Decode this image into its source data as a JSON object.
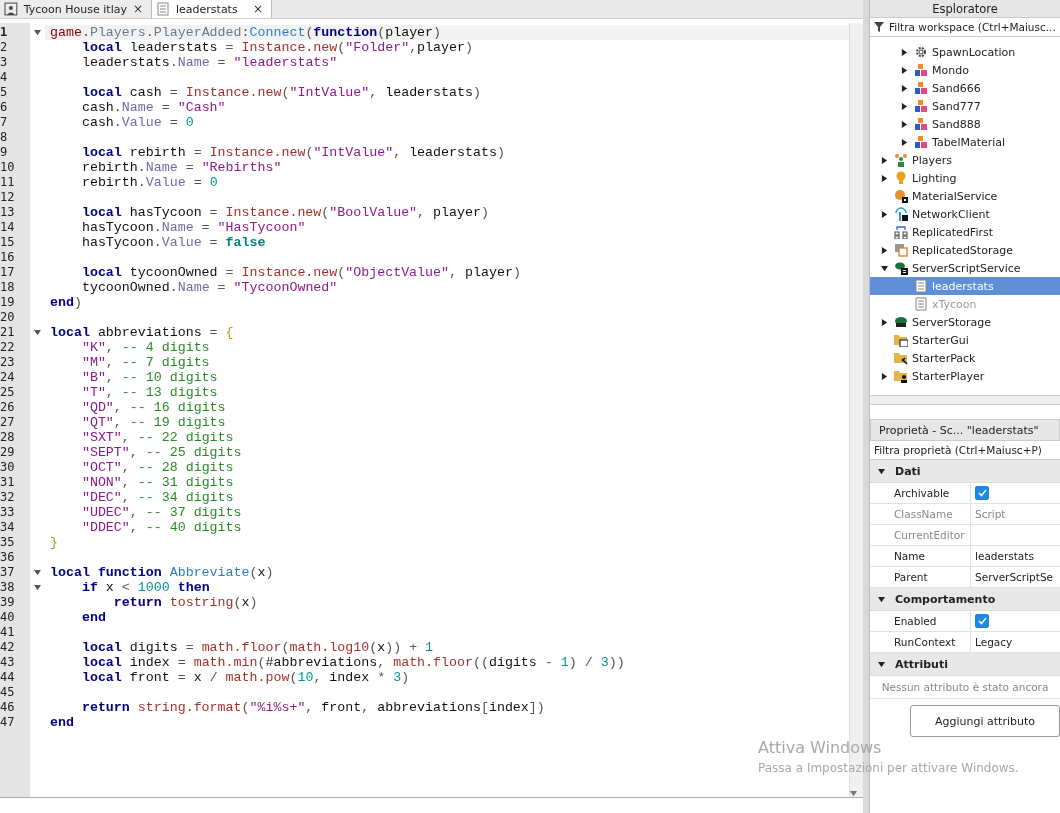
{
  "editor": {
    "tabs": [
      {
        "label": "Tycoon House itlay",
        "close": "×",
        "selected": false
      },
      {
        "label": "leaderstats",
        "close": "×",
        "selected": true
      }
    ],
    "lines": [
      {
        "n": "1",
        "fold": true,
        "current": true,
        "tokens": [
          {
            "kind": "g",
            "text": "game"
          },
          {
            "kind": "op",
            "text": "."
          },
          {
            "kind": "mem",
            "text": "Players"
          },
          {
            "kind": "op",
            "text": "."
          },
          {
            "kind": "mem",
            "text": "PlayerAdded"
          },
          {
            "kind": "op",
            "text": ":"
          },
          {
            "kind": "meth",
            "text": "Connect"
          },
          {
            "kind": "op",
            "text": "("
          },
          {
            "kind": "kw",
            "text": "function"
          },
          {
            "kind": "op",
            "text": "("
          },
          {
            "kind": "id",
            "text": "player"
          },
          {
            "kind": "op",
            "text": ")"
          }
        ]
      },
      {
        "n": "2",
        "fold": false,
        "current": false,
        "tokens": [
          {
            "kind": "kw",
            "text": "    local"
          },
          {
            "kind": "id",
            "text": " leaderstats "
          },
          {
            "kind": "op",
            "text": "= "
          },
          {
            "kind": "fn",
            "text": "Instance.new"
          },
          {
            "kind": "op",
            "text": "("
          },
          {
            "kind": "str",
            "text": "\"Folder\""
          },
          {
            "kind": "op",
            "text": ","
          },
          {
            "kind": "id",
            "text": "player"
          },
          {
            "kind": "op",
            "text": ")"
          }
        ]
      },
      {
        "n": "3",
        "fold": false,
        "current": false,
        "tokens": [
          {
            "kind": "id",
            "text": "    leaderstats"
          },
          {
            "kind": "op",
            "text": "."
          },
          {
            "kind": "prop",
            "text": "Name"
          },
          {
            "kind": "op",
            "text": " = "
          },
          {
            "kind": "str",
            "text": "\"leaderstats\""
          }
        ]
      },
      {
        "n": "4",
        "fold": false,
        "current": false
      },
      {
        "n": "5",
        "fold": false,
        "current": false,
        "tokens": [
          {
            "kind": "kw",
            "text": "    local"
          },
          {
            "kind": "id",
            "text": " cash "
          },
          {
            "kind": "op",
            "text": "= "
          },
          {
            "kind": "fn",
            "text": "Instance.new"
          },
          {
            "kind": "op",
            "text": "("
          },
          {
            "kind": "str",
            "text": "\"IntValue\""
          },
          {
            "kind": "op",
            "text": ", "
          },
          {
            "kind": "id",
            "text": "leaderstats"
          },
          {
            "kind": "op",
            "text": ")"
          }
        ]
      },
      {
        "n": "6",
        "fold": false,
        "current": false,
        "tokens": [
          {
            "kind": "id",
            "text": "    cash"
          },
          {
            "kind": "op",
            "text": "."
          },
          {
            "kind": "prop",
            "text": "Name"
          },
          {
            "kind": "op",
            "text": " = "
          },
          {
            "kind": "str",
            "text": "\"Cash\""
          }
        ]
      },
      {
        "n": "7",
        "fold": false,
        "current": false,
        "tokens": [
          {
            "kind": "id",
            "text": "    cash"
          },
          {
            "kind": "op",
            "text": "."
          },
          {
            "kind": "prop",
            "text": "Value"
          },
          {
            "kind": "op",
            "text": " = "
          },
          {
            "kind": "num",
            "text": "0"
          }
        ]
      },
      {
        "n": "8",
        "fold": false,
        "current": false
      },
      {
        "n": "9",
        "fold": false,
        "current": false,
        "tokens": [
          {
            "kind": "kw",
            "text": "    local"
          },
          {
            "kind": "id",
            "text": " rebirth "
          },
          {
            "kind": "op",
            "text": "= "
          },
          {
            "kind": "fn",
            "text": "Instance.new"
          },
          {
            "kind": "op",
            "text": "("
          },
          {
            "kind": "str",
            "text": "\"IntValue\""
          },
          {
            "kind": "op",
            "text": ", "
          },
          {
            "kind": "id",
            "text": "leaderstats"
          },
          {
            "kind": "op",
            "text": ")"
          }
        ]
      },
      {
        "n": "10",
        "fold": false,
        "current": false,
        "tokens": [
          {
            "kind": "id",
            "text": "    rebirth"
          },
          {
            "kind": "op",
            "text": "."
          },
          {
            "kind": "prop",
            "text": "Name"
          },
          {
            "kind": "op",
            "text": " = "
          },
          {
            "kind": "str",
            "text": "\"Rebirths\""
          }
        ]
      },
      {
        "n": "11",
        "fold": false,
        "current": false,
        "tokens": [
          {
            "kind": "id",
            "text": "    rebirth"
          },
          {
            "kind": "op",
            "text": "."
          },
          {
            "kind": "prop",
            "text": "Value"
          },
          {
            "kind": "op",
            "text": " = "
          },
          {
            "kind": "num",
            "text": "0"
          }
        ]
      },
      {
        "n": "12",
        "fold": false,
        "current": false
      },
      {
        "n": "13",
        "fold": false,
        "current": false,
        "tokens": [
          {
            "kind": "kw",
            "text": "    local"
          },
          {
            "kind": "id",
            "text": " hasTycoon "
          },
          {
            "kind": "op",
            "text": "= "
          },
          {
            "kind": "fn",
            "text": "Instance.new"
          },
          {
            "kind": "op",
            "text": "("
          },
          {
            "kind": "str",
            "text": "\"BoolValue\""
          },
          {
            "kind": "op",
            "text": ", "
          },
          {
            "kind": "id",
            "text": "player"
          },
          {
            "kind": "op",
            "text": ")"
          }
        ]
      },
      {
        "n": "14",
        "fold": false,
        "current": false,
        "tokens": [
          {
            "kind": "id",
            "text": "    hasTycoon"
          },
          {
            "kind": "op",
            "text": "."
          },
          {
            "kind": "prop",
            "text": "Name"
          },
          {
            "kind": "op",
            "text": " = "
          },
          {
            "kind": "str",
            "text": "\"HasTycoon\""
          }
        ]
      },
      {
        "n": "15",
        "fold": false,
        "current": false,
        "tokens": [
          {
            "kind": "id",
            "text": "    hasTycoon"
          },
          {
            "kind": "op",
            "text": "."
          },
          {
            "kind": "prop",
            "text": "Value"
          },
          {
            "kind": "op",
            "text": " = "
          },
          {
            "kind": "bool",
            "text": "false"
          }
        ]
      },
      {
        "n": "16",
        "fold": false,
        "current": false
      },
      {
        "n": "17",
        "fold": false,
        "current": false,
        "tokens": [
          {
            "kind": "kw",
            "text": "    local"
          },
          {
            "kind": "id",
            "text": " tycoonOwned "
          },
          {
            "kind": "op",
            "text": "= "
          },
          {
            "kind": "fn",
            "text": "Instance.new"
          },
          {
            "kind": "op",
            "text": "("
          },
          {
            "kind": "str",
            "text": "\"ObjectValue\""
          },
          {
            "kind": "op",
            "text": ", "
          },
          {
            "kind": "id",
            "text": "player"
          },
          {
            "kind": "op",
            "text": ")"
          }
        ]
      },
      {
        "n": "18",
        "fold": false,
        "current": false,
        "tokens": [
          {
            "kind": "id",
            "text": "    tycoonOwned"
          },
          {
            "kind": "op",
            "text": "."
          },
          {
            "kind": "prop",
            "text": "Name"
          },
          {
            "kind": "op",
            "text": " = "
          },
          {
            "kind": "str",
            "text": "\"TycoonOwned\""
          }
        ]
      },
      {
        "n": "19",
        "fold": false,
        "current": false,
        "tokens": [
          {
            "kind": "kw",
            "text": "end"
          },
          {
            "kind": "op",
            "text": ")"
          }
        ]
      },
      {
        "n": "20",
        "fold": false,
        "current": false
      },
      {
        "n": "21",
        "fold": true,
        "current": false,
        "tokens": [
          {
            "kind": "kw",
            "text": "local"
          },
          {
            "kind": "id",
            "text": " abbreviations "
          },
          {
            "kind": "op",
            "text": "= "
          },
          {
            "kind": "brace",
            "text": "{"
          }
        ]
      },
      {
        "n": "22",
        "fold": false,
        "current": false,
        "tokens": [
          {
            "kind": "str",
            "text": "    \"K\""
          },
          {
            "kind": "op",
            "text": ", "
          },
          {
            "kind": "com",
            "text": "-- 4 digits"
          }
        ]
      },
      {
        "n": "23",
        "fold": false,
        "current": false,
        "tokens": [
          {
            "kind": "str",
            "text": "    \"M\""
          },
          {
            "kind": "op",
            "text": ", "
          },
          {
            "kind": "com",
            "text": "-- 7 digits"
          }
        ]
      },
      {
        "n": "24",
        "fold": false,
        "current": false,
        "tokens": [
          {
            "kind": "str",
            "text": "    \"B\""
          },
          {
            "kind": "op",
            "text": ", "
          },
          {
            "kind": "com",
            "text": "-- 10 digits"
          }
        ]
      },
      {
        "n": "25",
        "fold": false,
        "current": false,
        "tokens": [
          {
            "kind": "str",
            "text": "    \"T\""
          },
          {
            "kind": "op",
            "text": ", "
          },
          {
            "kind": "com",
            "text": "-- 13 digits"
          }
        ]
      },
      {
        "n": "26",
        "fold": false,
        "current": false,
        "tokens": [
          {
            "kind": "str",
            "text": "    \"QD\""
          },
          {
            "kind": "op",
            "text": ", "
          },
          {
            "kind": "com",
            "text": "-- 16 digits"
          }
        ]
      },
      {
        "n": "27",
        "fold": false,
        "current": false,
        "tokens": [
          {
            "kind": "str",
            "text": "    \"QT\""
          },
          {
            "kind": "op",
            "text": ", "
          },
          {
            "kind": "com",
            "text": "-- 19 digits"
          }
        ]
      },
      {
        "n": "28",
        "fold": false,
        "current": false,
        "tokens": [
          {
            "kind": "str",
            "text": "    \"SXT\""
          },
          {
            "kind": "op",
            "text": ", "
          },
          {
            "kind": "com",
            "text": "-- 22 digits"
          }
        ]
      },
      {
        "n": "29",
        "fold": false,
        "current": false,
        "tokens": [
          {
            "kind": "str",
            "text": "    \"SEPT\""
          },
          {
            "kind": "op",
            "text": ", "
          },
          {
            "kind": "com",
            "text": "-- 25 digits"
          }
        ]
      },
      {
        "n": "30",
        "fold": false,
        "current": false,
        "tokens": [
          {
            "kind": "str",
            "text": "    \"OCT\""
          },
          {
            "kind": "op",
            "text": ", "
          },
          {
            "kind": "com",
            "text": "-- 28 digits"
          }
        ]
      },
      {
        "n": "31",
        "fold": false,
        "current": false,
        "tokens": [
          {
            "kind": "str",
            "text": "    \"NON\""
          },
          {
            "kind": "op",
            "text": ", "
          },
          {
            "kind": "com",
            "text": "-- 31 digits"
          }
        ]
      },
      {
        "n": "32",
        "fold": false,
        "current": false,
        "tokens": [
          {
            "kind": "str",
            "text": "    \"DEC\""
          },
          {
            "kind": "op",
            "text": ", "
          },
          {
            "kind": "com",
            "text": "-- 34 digits"
          }
        ]
      },
      {
        "n": "33",
        "fold": false,
        "current": false,
        "tokens": [
          {
            "kind": "str",
            "text": "    \"UDEC\""
          },
          {
            "kind": "op",
            "text": ", "
          },
          {
            "kind": "com",
            "text": "-- 37 digits"
          }
        ]
      },
      {
        "n": "34",
        "fold": false,
        "current": false,
        "tokens": [
          {
            "kind": "str",
            "text": "    \"DDEC\""
          },
          {
            "kind": "op",
            "text": ", "
          },
          {
            "kind": "com",
            "text": "-- 40 digits"
          }
        ]
      },
      {
        "n": "35",
        "fold": false,
        "current": false,
        "tokens": [
          {
            "kind": "brace",
            "text": "}"
          }
        ]
      },
      {
        "n": "36",
        "fold": false,
        "current": false
      },
      {
        "n": "37",
        "fold": true,
        "current": false,
        "tokens": [
          {
            "kind": "kw",
            "text": "local function "
          },
          {
            "kind": "meth",
            "text": "Abbreviate"
          },
          {
            "kind": "op",
            "text": "("
          },
          {
            "kind": "id",
            "text": "x"
          },
          {
            "kind": "op",
            "text": ")"
          }
        ]
      },
      {
        "n": "38",
        "fold": true,
        "current": false,
        "tokens": [
          {
            "kind": "kw",
            "text": "    if"
          },
          {
            "kind": "id",
            "text": " x "
          },
          {
            "kind": "op",
            "text": "< "
          },
          {
            "kind": "num",
            "text": "1000"
          },
          {
            "kind": "kw",
            "text": " then"
          }
        ]
      },
      {
        "n": "39",
        "fold": false,
        "current": false,
        "tokens": [
          {
            "kind": "kw",
            "text": "        return"
          },
          {
            "kind": "fn",
            "text": " tostring"
          },
          {
            "kind": "op",
            "text": "("
          },
          {
            "kind": "id",
            "text": "x"
          },
          {
            "kind": "op",
            "text": ")"
          }
        ]
      },
      {
        "n": "40",
        "fold": false,
        "current": false,
        "tokens": [
          {
            "kind": "kw",
            "text": "    end"
          }
        ]
      },
      {
        "n": "41",
        "fold": false,
        "current": false
      },
      {
        "n": "42",
        "fold": false,
        "current": false,
        "tokens": [
          {
            "kind": "kw",
            "text": "    local"
          },
          {
            "kind": "id",
            "text": " digits "
          },
          {
            "kind": "op",
            "text": "= "
          },
          {
            "kind": "fn",
            "text": "math.floor"
          },
          {
            "kind": "op",
            "text": "("
          },
          {
            "kind": "fn",
            "text": "math.log10"
          },
          {
            "kind": "op",
            "text": "("
          },
          {
            "kind": "id",
            "text": "x"
          },
          {
            "kind": "op",
            "text": ")) + "
          },
          {
            "kind": "num",
            "text": "1"
          }
        ]
      },
      {
        "n": "43",
        "fold": false,
        "current": false,
        "tokens": [
          {
            "kind": "kw",
            "text": "    local"
          },
          {
            "kind": "id",
            "text": " index "
          },
          {
            "kind": "op",
            "text": "= "
          },
          {
            "kind": "fn",
            "text": "math.min"
          },
          {
            "kind": "op",
            "text": "("
          },
          {
            "kind": "id",
            "text": "#abbreviations"
          },
          {
            "kind": "op",
            "text": ", "
          },
          {
            "kind": "fn",
            "text": "math.floor"
          },
          {
            "kind": "op",
            "text": "(("
          },
          {
            "kind": "id",
            "text": "digits "
          },
          {
            "kind": "op",
            "text": "- "
          },
          {
            "kind": "num",
            "text": "1"
          },
          {
            "kind": "op",
            "text": ") / "
          },
          {
            "kind": "num",
            "text": "3"
          },
          {
            "kind": "op",
            "text": "))"
          }
        ]
      },
      {
        "n": "44",
        "fold": false,
        "current": false,
        "tokens": [
          {
            "kind": "kw",
            "text": "    local"
          },
          {
            "kind": "id",
            "text": " front "
          },
          {
            "kind": "op",
            "text": "= "
          },
          {
            "kind": "id",
            "text": "x "
          },
          {
            "kind": "op",
            "text": "/ "
          },
          {
            "kind": "fn",
            "text": "math.pow"
          },
          {
            "kind": "op",
            "text": "("
          },
          {
            "kind": "num",
            "text": "10"
          },
          {
            "kind": "op",
            "text": ", "
          },
          {
            "kind": "id",
            "text": "index "
          },
          {
            "kind": "op",
            "text": "* "
          },
          {
            "kind": "num",
            "text": "3"
          },
          {
            "kind": "op",
            "text": ")"
          }
        ]
      },
      {
        "n": "45",
        "fold": false,
        "current": false
      },
      {
        "n": "46",
        "fold": false,
        "current": false,
        "tokens": [
          {
            "kind": "kw",
            "text": "    return"
          },
          {
            "kind": "fn",
            "text": " string.format"
          },
          {
            "kind": "op",
            "text": "("
          },
          {
            "kind": "str",
            "text": "\"%i%s+\""
          },
          {
            "kind": "op",
            "text": ", "
          },
          {
            "kind": "id",
            "text": "front"
          },
          {
            "kind": "op",
            "text": ", "
          },
          {
            "kind": "id",
            "text": "abbreviations"
          },
          {
            "kind": "op",
            "text": "["
          },
          {
            "kind": "id",
            "text": "index"
          },
          {
            "kind": "op",
            "text": "])"
          }
        ]
      },
      {
        "n": "47",
        "fold": false,
        "current": false,
        "tokens": [
          {
            "kind": "kw",
            "text": "end"
          }
        ]
      }
    ]
  },
  "explorer": {
    "title": "Esploratore",
    "filter_placeholder": "Filtra workspace (Ctrl+Maiusc...",
    "items": [
      {
        "label": "SpawnLocation",
        "expandable": true,
        "expanded": false,
        "selected": false,
        "dim": false
      },
      {
        "label": "Mondo",
        "expandable": true,
        "expanded": false,
        "selected": false,
        "dim": false
      },
      {
        "label": "Sand666",
        "expandable": true,
        "expanded": false,
        "selected": false,
        "dim": false
      },
      {
        "label": "Sand777",
        "expandable": true,
        "expanded": false,
        "selected": false,
        "dim": false
      },
      {
        "label": "Sand888",
        "expandable": true,
        "expanded": false,
        "selected": false,
        "dim": false
      },
      {
        "label": "TabelMaterial",
        "expandable": true,
        "expanded": false,
        "selected": false,
        "dim": false
      }
    ],
    "services": [
      {
        "label": "Players",
        "expandable": true,
        "expanded": false,
        "selected": false,
        "dim": false
      },
      {
        "label": "Lighting",
        "expandable": true,
        "expanded": false,
        "selected": false,
        "dim": false
      },
      {
        "label": "MaterialService",
        "expandable": false,
        "expanded": false,
        "selected": false,
        "dim": false
      },
      {
        "label": "NetworkClient",
        "expandable": true,
        "expanded": false,
        "selected": false,
        "dim": false
      },
      {
        "label": "ReplicatedFirst",
        "expandable": false,
        "expanded": false,
        "selected": false,
        "dim": false
      },
      {
        "label": "ReplicatedStorage",
        "expandable": true,
        "expanded": false,
        "selected": false,
        "dim": false
      },
      {
        "label": "ServerScriptService",
        "expandable": true,
        "expanded": true,
        "selected": false,
        "dim": false,
        "children": [
          {
            "label": "leaderstats",
            "expandable": false,
            "expanded": false,
            "selected": true,
            "dim": false
          },
          {
            "label": "xTycoon",
            "expandable": false,
            "expanded": false,
            "selected": false,
            "dim": true
          }
        ]
      },
      {
        "label": "ServerStorage",
        "expandable": true,
        "expanded": false,
        "selected": false,
        "dim": false
      },
      {
        "label": "StarterGui",
        "expandable": false,
        "expanded": false,
        "selected": false,
        "dim": false
      },
      {
        "label": "StarterPack",
        "expandable": false,
        "expanded": false,
        "selected": false,
        "dim": false
      },
      {
        "label": "StarterPlayer",
        "expandable": true,
        "expanded": false,
        "selected": false,
        "dim": false
      }
    ]
  },
  "properties": {
    "title": "Proprietà - Sc... \"leaderstats\"",
    "filter_placeholder": "Filtra proprietà (Ctrl+Maiusc+P)",
    "sections": [
      {
        "name": "Dati",
        "expanded": true,
        "rows": [
          {
            "name": "Archivable",
            "kind": "checkbox",
            "checked": true,
            "dim": false
          },
          {
            "name": "ClassName",
            "kind": "text",
            "value": "Script",
            "dim": true
          },
          {
            "name": "CurrentEditor",
            "kind": "text",
            "dim": true
          },
          {
            "name": "Name",
            "kind": "text",
            "value": "leaderstats",
            "dim": false
          },
          {
            "name": "Parent",
            "kind": "text",
            "value": "ServerScriptSe",
            "dim": false
          }
        ]
      },
      {
        "name": "Comportamento",
        "expanded": true,
        "rows": [
          {
            "name": "Enabled",
            "kind": "checkbox",
            "checked": true,
            "dim": false
          },
          {
            "name": "RunContext",
            "kind": "text",
            "value": "Legacy",
            "dim": false
          }
        ]
      },
      {
        "name": "Attributi",
        "expanded": true,
        "empty_text": "Nessun attributo è stato ancora",
        "button": "Aggiungi attributo"
      }
    ]
  },
  "os_notice": {
    "title": "Attiva Windows",
    "text": "Passa a Impostazioni per attivare Windows."
  }
}
